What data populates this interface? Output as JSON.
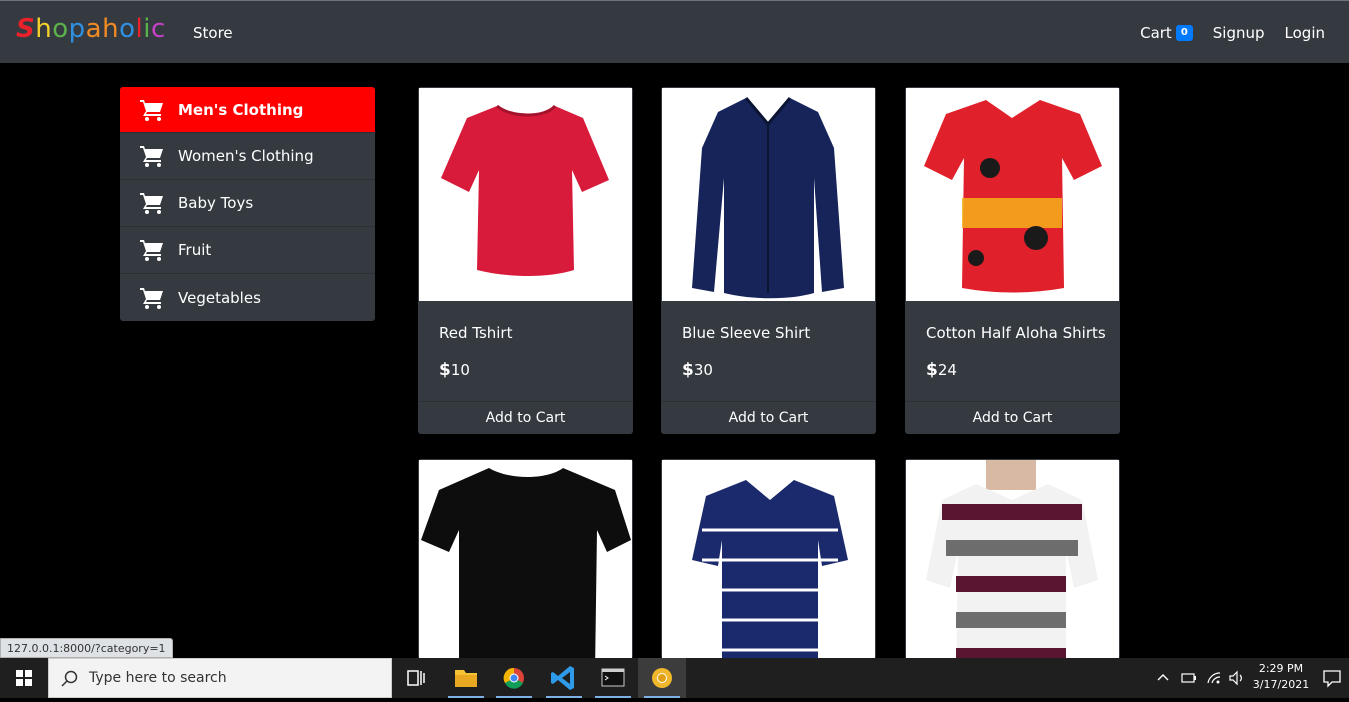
{
  "navbar": {
    "brand_letters": [
      {
        "ch": "S",
        "color": "#e8212b"
      },
      {
        "ch": "h",
        "color": "#f4d12b"
      },
      {
        "ch": "o",
        "color": "#5bb14a"
      },
      {
        "ch": "p",
        "color": "#2f8fe0"
      },
      {
        "ch": "a",
        "color": "#f08a24"
      },
      {
        "ch": "h",
        "color": "#f08a24"
      },
      {
        "ch": "o",
        "color": "#2f8fe0"
      },
      {
        "ch": "l",
        "color": "#e8212b"
      },
      {
        "ch": "i",
        "color": "#5bb14a"
      },
      {
        "ch": "c",
        "color": "#c742c7"
      }
    ],
    "store": "Store",
    "cart": "Cart",
    "cart_count": "0",
    "signup": "Signup",
    "login": "Login"
  },
  "sidebar": {
    "items": [
      {
        "label": "Men's Clothing",
        "active": true,
        "icon": "shopping-cart-icon"
      },
      {
        "label": "Women's Clothing",
        "active": false,
        "icon": "shopping-cart-icon"
      },
      {
        "label": "Baby Toys",
        "active": false,
        "icon": "shopping-cart-icon"
      },
      {
        "label": "Fruit",
        "active": false,
        "icon": "shopping-cart-icon"
      },
      {
        "label": "Vegetables",
        "active": false,
        "icon": "shopping-cart-icon"
      }
    ],
    "active_color": "#ff0000"
  },
  "products": [
    {
      "name": "Red Tshirt",
      "currency": "$",
      "price": "10",
      "button": "Add to Cart",
      "image": "red-tshirt"
    },
    {
      "name": "Blue Sleeve Shirt",
      "currency": "$",
      "price": "30",
      "button": "Add to Cart",
      "image": "blue-shirt"
    },
    {
      "name": "Cotton Half Aloha Shirts",
      "currency": "$",
      "price": "24",
      "button": "Add to Cart",
      "image": "aloha-shirt"
    },
    {
      "image": "black-tshirt"
    },
    {
      "image": "blue-striped-polo"
    },
    {
      "image": "striped-polo"
    }
  ],
  "status_bar": {
    "url": "127.0.0.1:8000/?category=1"
  },
  "taskbar": {
    "search_placeholder": "Type here to search",
    "time": "2:29 PM",
    "date": "3/17/2021"
  }
}
